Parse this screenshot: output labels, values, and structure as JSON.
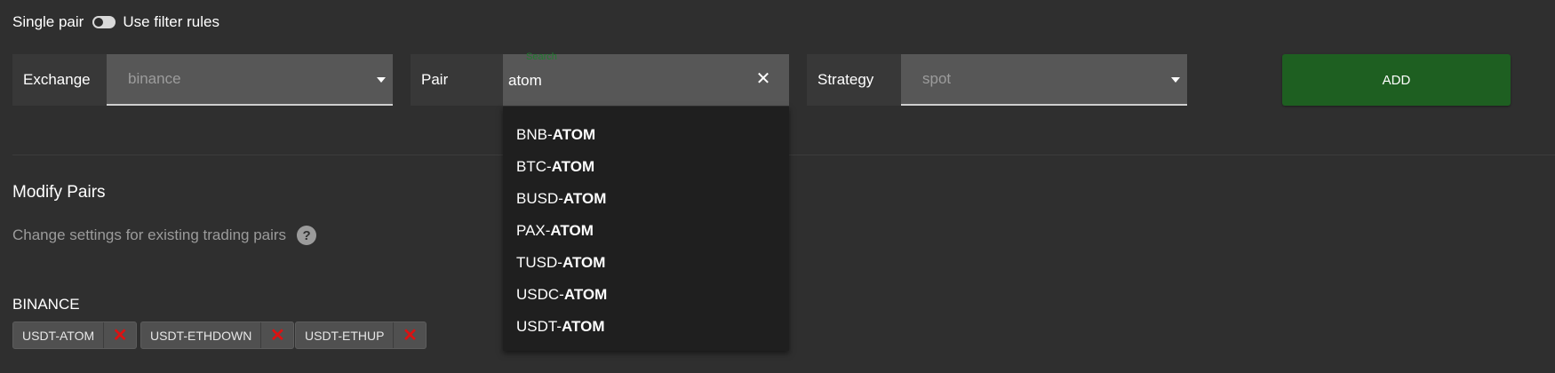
{
  "toggle": {
    "left_label": "Single pair",
    "right_label": "Use filter rules"
  },
  "form": {
    "exchange": {
      "label": "Exchange",
      "value": "binance"
    },
    "pair": {
      "label": "Pair",
      "search_hint": "Search",
      "value": "atom"
    },
    "strategy": {
      "label": "Strategy",
      "value": "spot"
    },
    "add_label": "ADD"
  },
  "dropdown": {
    "items": [
      {
        "prefix": "BNB-",
        "match": "ATOM"
      },
      {
        "prefix": "BTC-",
        "match": "ATOM"
      },
      {
        "prefix": "BUSD-",
        "match": "ATOM"
      },
      {
        "prefix": "PAX-",
        "match": "ATOM"
      },
      {
        "prefix": "TUSD-",
        "match": "ATOM"
      },
      {
        "prefix": "USDC-",
        "match": "ATOM"
      },
      {
        "prefix": "USDT-",
        "match": "ATOM"
      }
    ]
  },
  "modify": {
    "title": "Modify Pairs",
    "description": "Change settings for existing trading pairs",
    "help_icon": "?"
  },
  "exchange_group": {
    "name": "BINANCE",
    "pairs": [
      "USDT-ATOM",
      "USDT-ETHDOWN",
      "USDT-ETHUP"
    ]
  },
  "icons": {
    "clear": "✕",
    "remove": "✕"
  },
  "colors": {
    "add_button": "#1e5f21",
    "remove_icon": "#dd1111",
    "search_hint": "#1f7a2e"
  }
}
